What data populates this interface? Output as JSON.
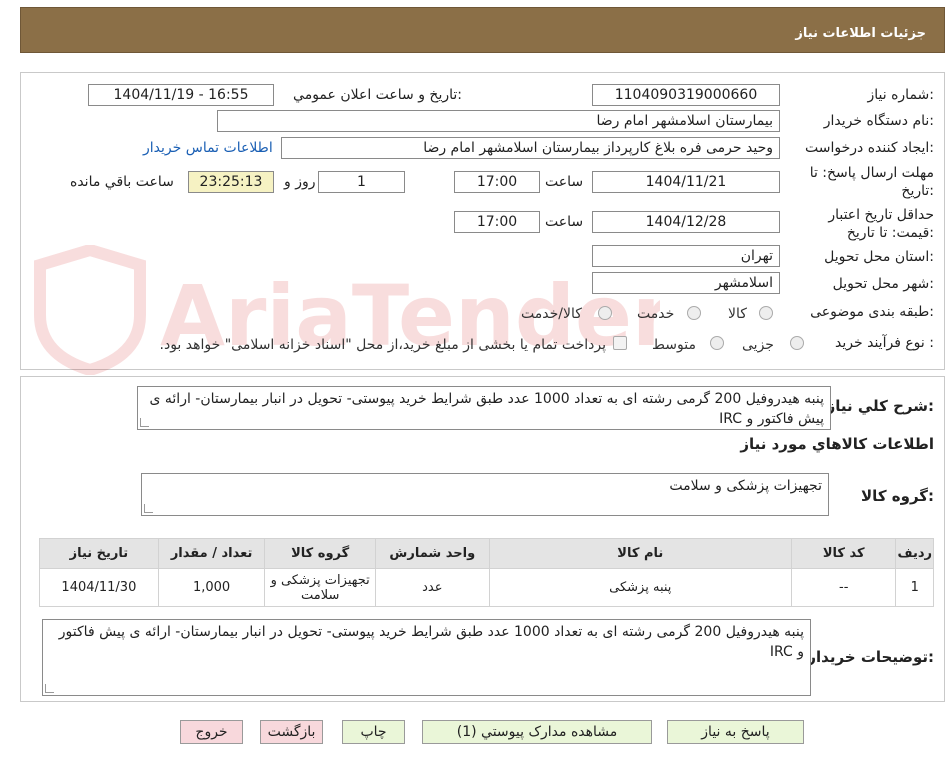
{
  "header": {
    "title": "جزئیات اطلاعات نیاز"
  },
  "watermark": {
    "text": "AriaTender.neT"
  },
  "form": {
    "need_number_label": "شماره نیاز:",
    "need_number": "1104090319000660",
    "announce_label": "تاریخ و ساعت اعلان عمومي:",
    "announce_value": "1404/11/19 - 16:55",
    "buyer_org_label": "نام دستگاه خریدار:",
    "buyer_org": "بیمارستان اسلامشهر   امام رضا",
    "creator_label": "ایجاد کننده درخواست:",
    "creator": "وحید حرمی فره بلاغ کارپرداز بیمارستان اسلامشهر   امام رضا",
    "contact_link": "اطلاعات تماس خریدار",
    "deadline_label_1": "مهلت ارسال پاسخ: تا",
    "deadline_label_2": "تاریخ:",
    "deadline_date": "1404/11/21",
    "time_label": "ساعت",
    "deadline_time": "17:00",
    "days_value": "1",
    "days_label": "روز و",
    "remaining_time": "23:25:13",
    "remaining_label": "ساعت باقي مانده",
    "validity_label_1": "حداقل تاریخ اعتبار",
    "validity_label_2": "قیمت: تا تاریخ:",
    "validity_date": "1404/12/28",
    "validity_time": "17:00",
    "province_label": "استان محل تحویل:",
    "province": "تهران",
    "city_label": "شهر محل تحویل:",
    "city": "اسلامشهر",
    "category_label": "طبقه بندی موضوعی:",
    "category_options": [
      "کالا",
      "خدمت",
      "کالا/خدمت"
    ],
    "process_label": "نوع فرآیند خرید :",
    "process_options": [
      "جزیی",
      "متوسط"
    ],
    "payment_note": "پرداخت تمام یا بخشی از مبلغ خرید،از محل \"اسناد خزانه اسلامی\" خواهد بود."
  },
  "summary": {
    "label": "شرح کلي نياز:",
    "text": "پنبه هیدروفیل 200 گرمی رشته ای به تعداد 1000 عدد طبق شرایط خرید پیوستی- تحویل در انبار بیمارستان- ارائه ی پیش فاکتور و IRC"
  },
  "goods": {
    "section_title": "اطلاعات کالاهاي مورد نياز",
    "group_label": "گروه کالا:",
    "group_value": "تجهیزات پزشکی و سلامت",
    "columns": [
      "رديف",
      "کد کالا",
      "نام کالا",
      "واحد شمارش",
      "گروه کالا",
      "تعداد / مقدار",
      "تاریخ نیاز"
    ],
    "rows": [
      {
        "row": "1",
        "code": "--",
        "name": "پنبه پزشکی",
        "unit": "عدد",
        "group": "تجهیزات پزشکی و سلامت",
        "qty": "1,000",
        "date": "1404/11/30"
      }
    ]
  },
  "buyer_notes": {
    "label": "توضیحات خریدار:",
    "text": "پنبه هیدروفیل 200 گرمی رشته ای به تعداد 1000 عدد طبق شرایط خرید پیوستی- تحویل در انبار بیمارستان- ارائه ی پیش فاکتور و IRC"
  },
  "buttons": {
    "reply": "پاسخ به نیاز",
    "attachments": "مشاهده مدارک پیوستي (1)",
    "print": "چاپ",
    "back": "بازگشت",
    "exit": "خروج"
  }
}
